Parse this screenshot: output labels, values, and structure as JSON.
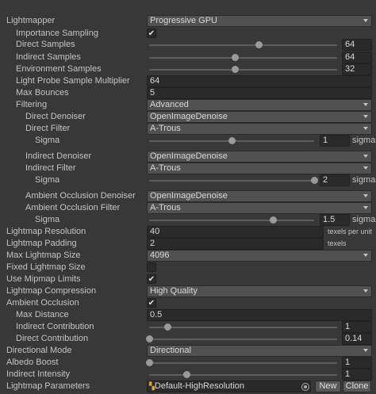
{
  "rows": [
    {
      "kind": "dropdown",
      "label": "Lightmapper",
      "value": "Progressive GPU"
    },
    {
      "kind": "checkbox",
      "label": "Importance Sampling",
      "checked": true
    },
    {
      "kind": "slider",
      "label": "Direct Samples",
      "value": "64",
      "fraction": 0.586
    },
    {
      "kind": "slider",
      "label": "Indirect Samples",
      "value": "64",
      "fraction": 0.457
    },
    {
      "kind": "slider",
      "label": "Environment Samples",
      "value": "32",
      "fraction": 0.457
    },
    {
      "kind": "field",
      "label": "Light Probe Sample Multiplier",
      "value": "64"
    },
    {
      "kind": "field",
      "label": "Max Bounces",
      "value": "5"
    },
    {
      "kind": "dropdown",
      "label": "Filtering",
      "value": "Advanced"
    },
    {
      "kind": "dropdown",
      "label": "Direct Denoiser",
      "value": "OpenImageDenoise"
    },
    {
      "kind": "dropdown",
      "label": "Direct Filter",
      "value": "A-Trous"
    },
    {
      "kind": "slider",
      "label": "Sigma",
      "value": "1",
      "fraction": 0.5,
      "unit": "sigma"
    },
    {
      "kind": "dropdown",
      "label": "Indirect Denoiser",
      "value": "OpenImageDenoise"
    },
    {
      "kind": "dropdown",
      "label": "Indirect Filter",
      "value": "A-Trous"
    },
    {
      "kind": "slider",
      "label": "Sigma",
      "value": "2",
      "fraction": 1.0,
      "unit": "sigma"
    },
    {
      "kind": "dropdown",
      "label": "Ambient Occlusion Denoiser",
      "value": "OpenImageDenoise"
    },
    {
      "kind": "dropdown",
      "label": "Ambient Occlusion Filter",
      "value": "A-Trous"
    },
    {
      "kind": "slider",
      "label": "Sigma",
      "value": "1.5",
      "fraction": 0.75,
      "unit": "sigma"
    },
    {
      "kind": "field",
      "label": "Lightmap Resolution",
      "value": "40",
      "unit": "texels per unit"
    },
    {
      "kind": "field",
      "label": "Lightmap Padding",
      "value": "2",
      "unit": "texels"
    },
    {
      "kind": "dropdown",
      "label": "Max Lightmap Size",
      "value": "4096"
    },
    {
      "kind": "checkbox",
      "label": "Fixed Lightmap Size",
      "checked": false
    },
    {
      "kind": "checkbox",
      "label": "Use Mipmap Limits",
      "checked": true
    },
    {
      "kind": "dropdown",
      "label": "Lightmap Compression",
      "value": "High Quality"
    },
    {
      "kind": "checkbox",
      "label": "Ambient Occlusion",
      "checked": true
    },
    {
      "kind": "field",
      "label": "Max Distance",
      "value": "0.5"
    },
    {
      "kind": "slider",
      "label": "Indirect Contribution",
      "value": "1",
      "fraction": 0.1
    },
    {
      "kind": "slider",
      "label": "Direct Contribution",
      "value": "0.14",
      "fraction": 0.0
    },
    {
      "kind": "dropdown",
      "label": "Directional Mode",
      "value": "Directional"
    },
    {
      "kind": "slider",
      "label": "Albedo Boost",
      "value": "1",
      "fraction": 0.0
    },
    {
      "kind": "slider",
      "label": "Indirect Intensity",
      "value": "1",
      "fraction": 0.2
    },
    {
      "kind": "asset",
      "label": "Lightmap Parameters",
      "value": "Default-HighResolution",
      "buttons": [
        "New",
        "Clone"
      ]
    }
  ],
  "check_glyph": "✔",
  "asset_icon_glyph": "▚"
}
